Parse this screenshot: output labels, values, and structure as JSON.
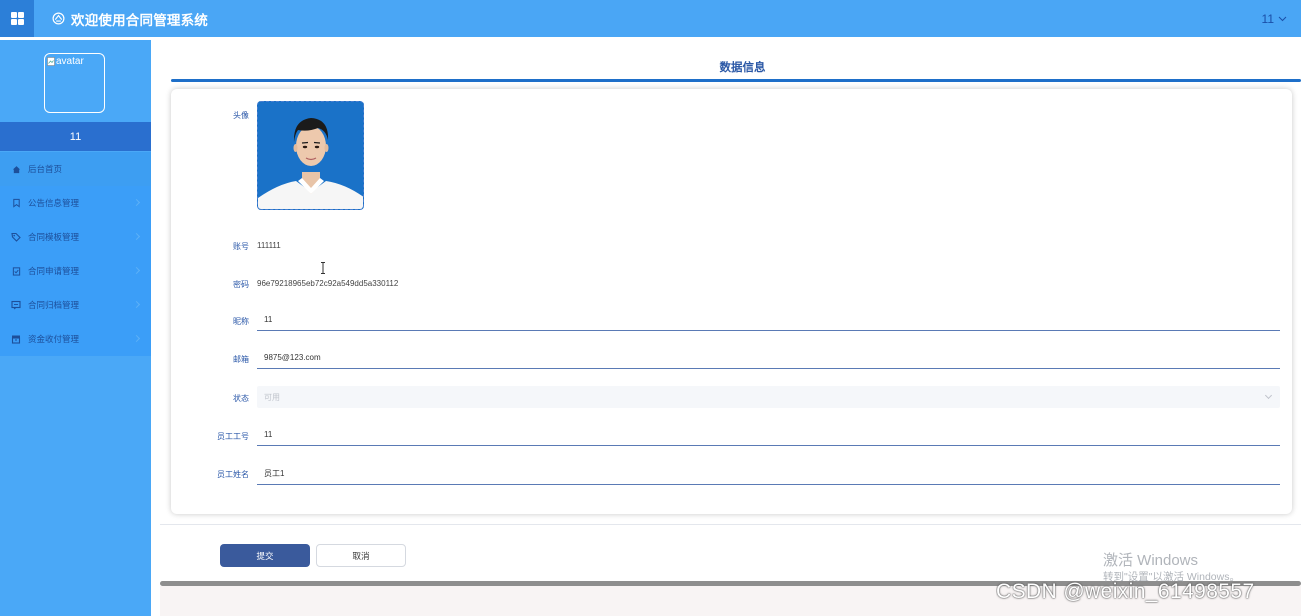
{
  "header": {
    "title": "欢迎使用合同管理系统",
    "user": "11"
  },
  "sidebar": {
    "avatar_alt": "avatar",
    "username": "11",
    "items": [
      {
        "label": "后台首页",
        "icon": "home-icon"
      },
      {
        "label": "公告信息管理",
        "icon": "bookmark-icon"
      },
      {
        "label": "合同模板管理",
        "icon": "tag-icon"
      },
      {
        "label": "合同申请管理",
        "icon": "clipboard-icon"
      },
      {
        "label": "合同归档管理",
        "icon": "message-icon"
      },
      {
        "label": "资金收付管理",
        "icon": "archive-icon"
      }
    ]
  },
  "main": {
    "title": "数据信息",
    "form": {
      "avatar_label": "头像",
      "account_label": "账号",
      "account_value": "111111",
      "password_label": "密码",
      "password_value": "96e79218965eb72c92a549dd5a330112",
      "nickname_label": "昵称",
      "nickname_value": "11",
      "email_label": "邮箱",
      "email_value": "9875@123.com",
      "status_label": "状态",
      "status_value": "可用",
      "emp_no_label": "员工工号",
      "emp_no_value": "11",
      "emp_name_label": "员工姓名",
      "emp_name_value": "员工1"
    },
    "buttons": {
      "submit": "提交",
      "cancel": "取消"
    }
  },
  "overlay": {
    "activate_title": "激活 Windows",
    "activate_sub": "转到\"设置\"以激活 Windows。",
    "csdn": "CSDN @weixin_61498557"
  },
  "colors": {
    "header": "#4aa6f5",
    "sidebar": "#4aa8f7",
    "accent": "#1e6fc9",
    "primary_button": "#3a5a9c"
  }
}
